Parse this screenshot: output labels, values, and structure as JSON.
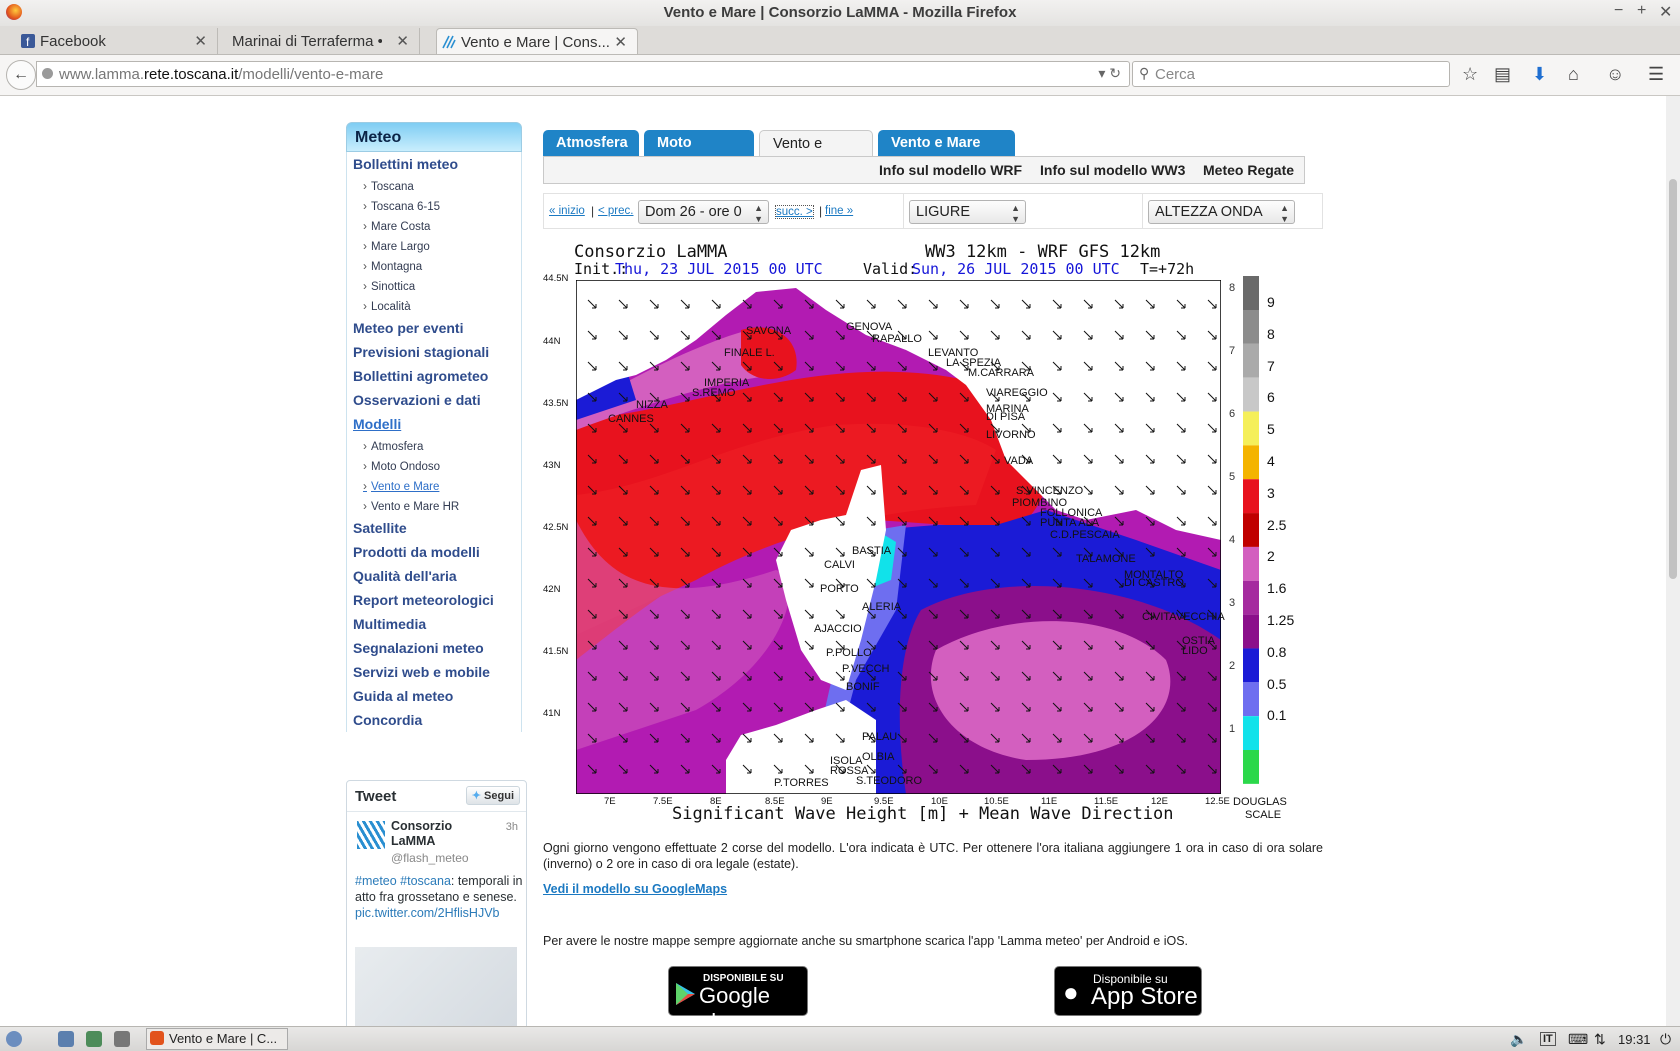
{
  "window": {
    "title": "Vento e Mare | Consorzio LaMMA - Mozilla Firefox"
  },
  "tabs": [
    {
      "label": "Facebook"
    },
    {
      "label": "Marinai di Terraferma • ..."
    },
    {
      "label": "Vento e Mare | Cons..."
    }
  ],
  "nav": {
    "url_prefix": "www.lamma.",
    "url_domain": "rete.toscana.it",
    "url_path": "/modelli/vento-e-mare",
    "search_placeholder": "Cerca"
  },
  "sidebar": {
    "heading": "Meteo",
    "items": [
      {
        "label": "Bollettini meteo",
        "level": 1
      },
      {
        "label": "Toscana",
        "level": 2
      },
      {
        "label": "Toscana 6-15",
        "level": 2
      },
      {
        "label": "Mare Costa",
        "level": 2
      },
      {
        "label": "Mare Largo",
        "level": 2
      },
      {
        "label": "Montagna",
        "level": 2
      },
      {
        "label": "Sinottica",
        "level": 2
      },
      {
        "label": "Località",
        "level": 2
      },
      {
        "label": "Meteo per eventi",
        "level": 1
      },
      {
        "label": "Previsioni stagionali",
        "level": 1
      },
      {
        "label": "Bollettini agrometeo",
        "level": 1
      },
      {
        "label": "Osservazioni e dati",
        "level": 1
      },
      {
        "label": "Modelli",
        "level": 1,
        "current": true
      },
      {
        "label": "Atmosfera",
        "level": 2
      },
      {
        "label": "Moto Ondoso",
        "level": 2
      },
      {
        "label": "Vento e Mare",
        "level": 2,
        "current": true
      },
      {
        "label": "Vento e Mare HR",
        "level": 2
      },
      {
        "label": "Satellite",
        "level": 1
      },
      {
        "label": "Prodotti da modelli",
        "level": 1
      },
      {
        "label": "Qualità dell'aria",
        "level": 1
      },
      {
        "label": "Report meteorologici",
        "level": 1
      },
      {
        "label": "Multimedia",
        "level": 1
      },
      {
        "label": "Segnalazioni meteo",
        "level": 1
      },
      {
        "label": "Servizi web e mobile",
        "level": 1
      },
      {
        "label": "Guida al meteo",
        "level": 1
      },
      {
        "label": "Concordia",
        "level": 1
      }
    ]
  },
  "tweet": {
    "header": "Tweet",
    "follow": "Segui",
    "author": "Consorzio LaMMA",
    "handle": "@flash_meteo",
    "time": "3h",
    "hashtags": "#meteo #toscana",
    "text": ": temporali in atto fra grossetano e senese.",
    "link": "pic.twitter.com/2HflisHJVb"
  },
  "main": {
    "tabs": [
      "Atmosfera",
      "Moto Ondoso",
      "Vento e Mare",
      "Vento e Mare HR"
    ],
    "active_tab": "Vento e Mare",
    "sublinks": [
      "Info sul modello WRF",
      "Info sul modello WW3",
      "Meteo Regate"
    ],
    "nav_links": {
      "start": "« inizio",
      "prev": "< prec.",
      "next": "succ. >",
      "end": "fine »"
    },
    "time_select": "Dom 26 - ore 0",
    "area_select": "LIGURE",
    "field_select": "ALTEZZA ONDA"
  },
  "map": {
    "org": "Consorzio LaMMA",
    "model": "WW3 12km - WRF GFS 12km",
    "init_label": "Init.:",
    "init_value": "Thu, 23 JUL 2015  00 UTC",
    "valid_label": "Valid:",
    "valid_value": "Sun, 26 JUL 2015  00 UTC",
    "lead": "T=+72h",
    "caption": "Significant Wave Height [m] + Mean Wave Direction",
    "lat_ticks": [
      "44.5N",
      "44N",
      "43.5N",
      "43N",
      "42.5N",
      "42N",
      "41.5N",
      "41N"
    ],
    "lon_ticks": [
      "7E",
      "7.5E",
      "8E",
      "8.5E",
      "9E",
      "9.5E",
      "10E",
      "10.5E",
      "11E",
      "11.5E",
      "12E",
      "12.5E"
    ],
    "legend_values": [
      "9",
      "8",
      "7",
      "6",
      "5",
      "4",
      "3",
      "2.5",
      "2",
      "1.6",
      "1.25",
      "0.8",
      "0.5",
      "0.1"
    ],
    "douglas_values": [
      "8",
      "7",
      "6",
      "5",
      "4",
      "3",
      "2",
      "1"
    ],
    "douglas_label_1": "DOUGLAS",
    "douglas_label_2": "SCALE",
    "legend_colors": [
      "#6a6a6a",
      "#8c8c8c",
      "#aaaaaa",
      "#c8c8c8",
      "#f5ef5a",
      "#f4b400",
      "#e8121e",
      "#c00000",
      "#d35fbf",
      "#a52a9f",
      "#8b0f8b",
      "#1b1bd6",
      "#6e6ef0",
      "#11e2ea",
      "#2bd84a"
    ],
    "cities": [
      "GENOVA",
      "RAPALLO",
      "SAVONA",
      "FINALE L.",
      "LEVANTO",
      "LA SPEZIA",
      "M.CARRARA",
      "IMPERIA",
      "S.REMO",
      "VIAREGGIO",
      "NIZZA",
      "CANNES",
      "MARINA",
      "DI PISA",
      "LIVORNO",
      "VADA",
      "S.VINCENZO",
      "PIOMBINO",
      "FOLLONICA",
      "PUNTA ALA",
      "C.D.PESCAIA",
      "BASTIA",
      "CALVI",
      "TALAMONE",
      "MONTALTO",
      "DI CASTRO",
      "PORTO",
      "ALERIA",
      "CIVITAVECCHIA",
      "AJACCIO",
      "OSTIA",
      "LIDO",
      "P.POLLO",
      "P.VECCH",
      "BONIF",
      "PALAU",
      "OLBIA",
      "ISOLA",
      "ROSSA",
      "P.TORRES",
      "S.TEODORO"
    ]
  },
  "footer": {
    "note": "Ogni giorno vengono effettuate 2 corse del modello. L'ora indicata è UTC. Per ottenere l'ora italiana aggiungere 1 ora in caso di ora solare (inverno) o 2 ore in caso di ora legale (estate).",
    "maps_link": "Vedi il modello su GoogleMaps",
    "app_note": "Per avere le nostre mappe sempre aggiornate anche su smartphone scarica l'app 'Lamma meteo' per Android e iOS.",
    "google_top": "DISPONIBILE SU",
    "google_main": "Google play",
    "apple_top": "Disponibile su",
    "apple_main": "App Store"
  },
  "taskbar": {
    "window_label": "Vento e Mare | C...",
    "lang": "IT",
    "clock": "19:31"
  }
}
